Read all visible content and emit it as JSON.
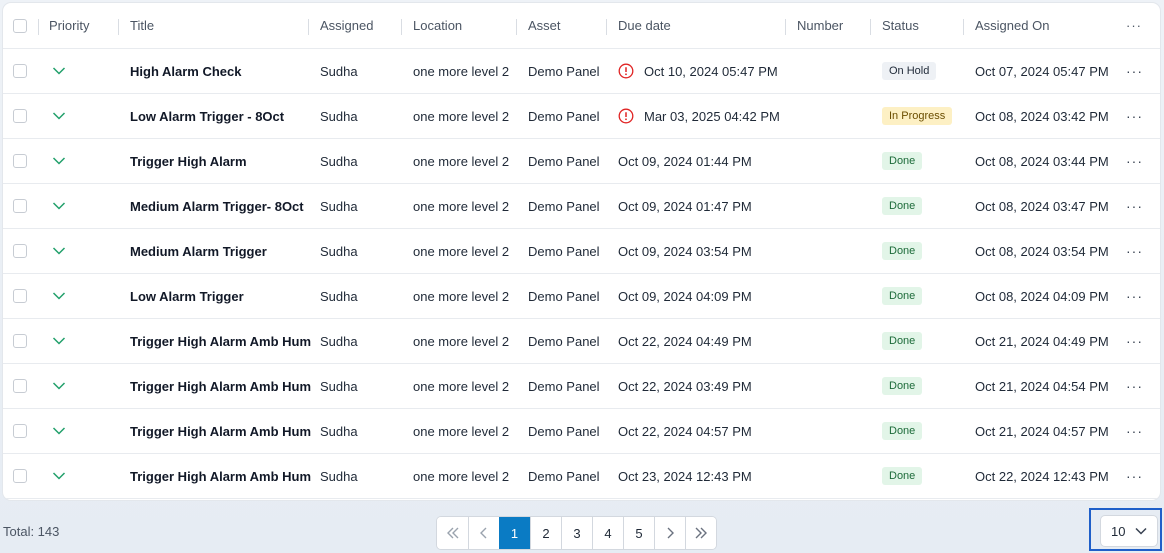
{
  "columns": {
    "priority": "Priority",
    "title": "Title",
    "assigned": "Assigned",
    "location": "Location",
    "asset": "Asset",
    "due_date": "Due date",
    "number": "Number",
    "status": "Status",
    "assigned_on": "Assigned On",
    "more": "···"
  },
  "rows": [
    {
      "title": "High Alarm Check",
      "assigned": "Sudha",
      "location": "one more level 2",
      "asset": "Demo Panel",
      "due": "Oct 10, 2024 05:47 PM",
      "overdue": true,
      "number": "",
      "status": "On Hold",
      "status_kind": "hold",
      "assigned_on": "Oct 07, 2024 05:47 PM"
    },
    {
      "title": "Low Alarm Trigger - 8Oct",
      "assigned": "Sudha",
      "location": "one more level 2",
      "asset": "Demo Panel",
      "due": "Mar 03, 2025 04:42 PM",
      "overdue": true,
      "number": "",
      "status": "In Progress",
      "status_kind": "progress",
      "assigned_on": "Oct 08, 2024 03:42 PM"
    },
    {
      "title": "Trigger High Alarm",
      "assigned": "Sudha",
      "location": "one more level 2",
      "asset": "Demo Panel",
      "due": "Oct 09, 2024 01:44 PM",
      "overdue": false,
      "number": "",
      "status": "Done",
      "status_kind": "done",
      "assigned_on": "Oct 08, 2024 03:44 PM"
    },
    {
      "title": "Medium Alarm Trigger- 8Oct",
      "assigned": "Sudha",
      "location": "one more level 2",
      "asset": "Demo Panel",
      "due": "Oct 09, 2024 01:47 PM",
      "overdue": false,
      "number": "",
      "status": "Done",
      "status_kind": "done",
      "assigned_on": "Oct 08, 2024 03:47 PM"
    },
    {
      "title": "Medium Alarm Trigger",
      "assigned": "Sudha",
      "location": "one more level 2",
      "asset": "Demo Panel",
      "due": "Oct 09, 2024 03:54 PM",
      "overdue": false,
      "number": "",
      "status": "Done",
      "status_kind": "done",
      "assigned_on": "Oct 08, 2024 03:54 PM"
    },
    {
      "title": "Low Alarm Trigger",
      "assigned": "Sudha",
      "location": "one more level 2",
      "asset": "Demo Panel",
      "due": "Oct 09, 2024 04:09 PM",
      "overdue": false,
      "number": "",
      "status": "Done",
      "status_kind": "done",
      "assigned_on": "Oct 08, 2024 04:09 PM"
    },
    {
      "title": "Trigger High Alarm Amb Hum",
      "assigned": "Sudha",
      "location": "one more level 2",
      "asset": "Demo Panel",
      "due": "Oct 22, 2024 04:49 PM",
      "overdue": false,
      "number": "",
      "status": "Done",
      "status_kind": "done",
      "assigned_on": "Oct 21, 2024 04:49 PM"
    },
    {
      "title": "Trigger High Alarm Amb Hum",
      "assigned": "Sudha",
      "location": "one more level 2",
      "asset": "Demo Panel",
      "due": "Oct 22, 2024 03:49 PM",
      "overdue": false,
      "number": "",
      "status": "Done",
      "status_kind": "done",
      "assigned_on": "Oct 21, 2024 04:54 PM"
    },
    {
      "title": "Trigger High Alarm Amb Hum",
      "assigned": "Sudha",
      "location": "one more level 2",
      "asset": "Demo Panel",
      "due": "Oct 22, 2024 04:57 PM",
      "overdue": false,
      "number": "",
      "status": "Done",
      "status_kind": "done",
      "assigned_on": "Oct 21, 2024 04:57 PM"
    },
    {
      "title": "Trigger High Alarm Amb Hum",
      "assigned": "Sudha",
      "location": "one more level 2",
      "asset": "Demo Panel",
      "due": "Oct 23, 2024 12:43 PM",
      "overdue": false,
      "number": "",
      "status": "Done",
      "status_kind": "done",
      "assigned_on": "Oct 22, 2024 12:43 PM"
    }
  ],
  "row_more": "···",
  "footer": {
    "total": "Total: 143",
    "pages": [
      "1",
      "2",
      "3",
      "4",
      "5"
    ],
    "current_page": "1",
    "page_size": "10"
  },
  "icons": {
    "priority": "chevron-down-icon",
    "overdue": "alert-circle-icon",
    "first": "double-chevron-left-icon",
    "prev": "chevron-left-icon",
    "next": "chevron-right-icon",
    "last": "double-chevron-right-icon"
  },
  "colors": {
    "priority_chevron": "#22a06b",
    "overdue_icon": "#e02424",
    "active_page": "#0a7bc4",
    "focus_outline": "#1f5fc9"
  }
}
